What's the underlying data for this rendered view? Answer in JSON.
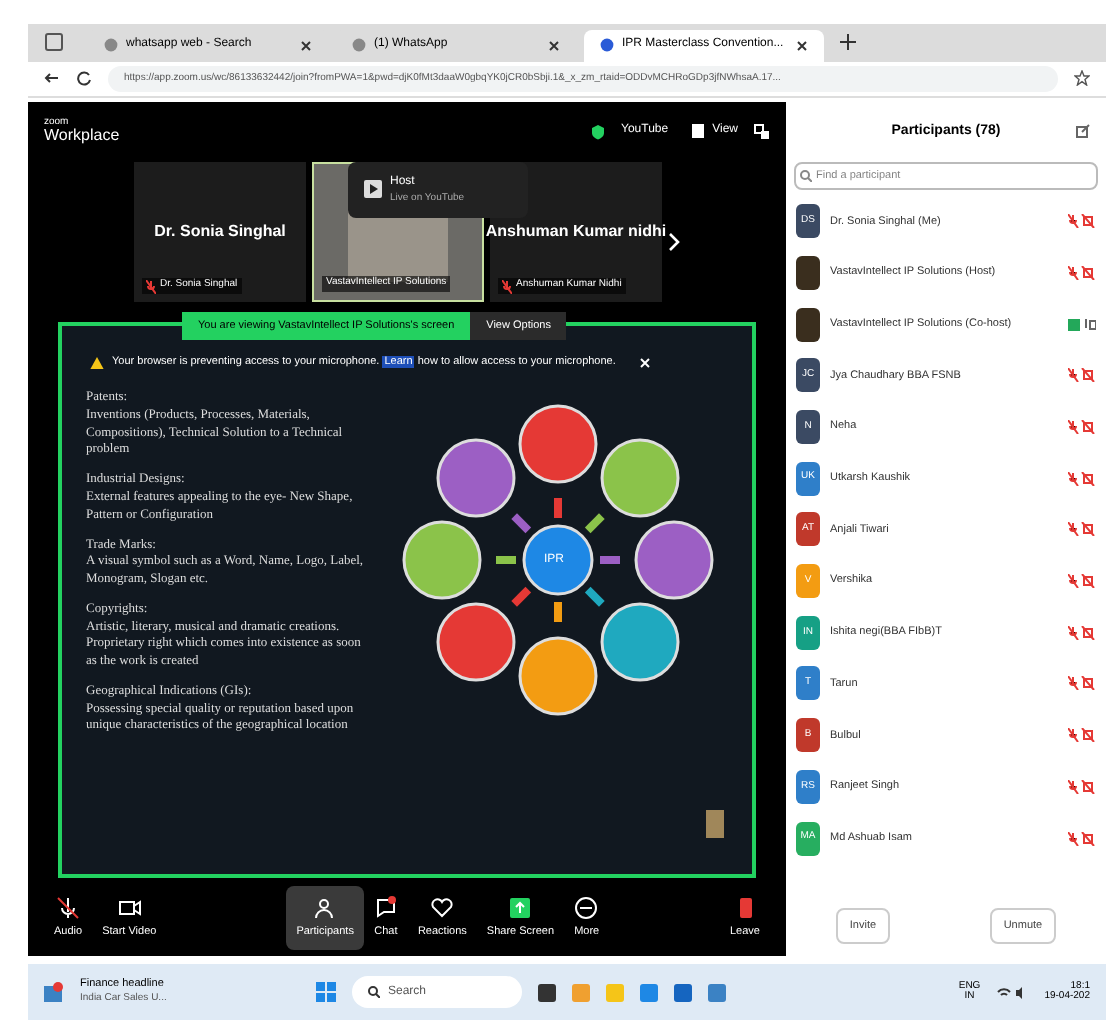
{
  "browser": {
    "tabs": [
      {
        "label": "whatsapp web - Search",
        "selected": false
      },
      {
        "label": "(1) WhatsApp",
        "selected": false
      },
      {
        "label": "IPR Masterclass Convention...",
        "selected": true
      }
    ],
    "url": "https://app.zoom.us/wc/86133632442/join?fromPWA=1&pwd=djK0fMt3daaW0gbqYK0jCR0bSbji.1&_x_zm_rtaid=ODDvMCHRoGDp3jfNWhsaA.17..."
  },
  "meeting": {
    "brand": "zoom",
    "product": "Workplace",
    "stream": "YouTube",
    "view": "View",
    "host_popup": {
      "title": "Host",
      "subtitle": "Live on YouTube"
    },
    "tiles": [
      {
        "kind": "name",
        "name": "Dr. Sonia Singhal",
        "caption": "Dr. Sonia Singhal",
        "muted": true
      },
      {
        "kind": "video",
        "caption": "VastavIntellect IP Solutions",
        "muted": false
      },
      {
        "kind": "name",
        "name": "Anshuman Kumar nidhi",
        "caption": "Anshuman Kumar Nidhi",
        "muted": true
      }
    ],
    "viewing_banner": "You are viewing VastavIntellect IP Solutions's screen",
    "view_options": "View Options",
    "warning": {
      "before": "Your browser is preventing access to your microphone.",
      "link": "Learn",
      "after": "how to allow access to your microphone."
    },
    "slide": {
      "paragraphs": [
        {
          "heading": "Patents:",
          "body": "Inventions (Products, Processes, Materials, Compositions), Technical Solution to a Technical problem"
        },
        {
          "heading": "Industrial Designs:",
          "body": "External features appealing to the eye- New Shape, Pattern or Configuration"
        },
        {
          "heading": "Trade Marks:",
          "body": "A visual symbol such as a Word, Name, Logo, Label, Monogram, Slogan etc."
        },
        {
          "heading": "Copyrights:",
          "body": "Artistic, literary, musical and dramatic creations. Proprietary right which comes into existence as soon as the work is created"
        },
        {
          "heading": "Geographical Indications (GIs):",
          "body": "Possessing special quality or reputation based upon unique characteristics of the geographical location"
        }
      ],
      "center": "IPR",
      "circles": [
        {
          "color": "#e53935"
        },
        {
          "color": "#8bc34a"
        },
        {
          "color": "#9c5fc4"
        },
        {
          "color": "#1fa9bf"
        },
        {
          "color": "#f39c12"
        },
        {
          "color": "#e53935"
        },
        {
          "color": "#8bc34a"
        },
        {
          "color": "#9c5fc4"
        }
      ]
    },
    "toolbar": [
      {
        "label": "Audio",
        "kind": "mic",
        "selected": false
      },
      {
        "label": "Start Video",
        "kind": "video",
        "selected": false
      },
      {
        "label": "Participants",
        "kind": "people",
        "selected": true
      },
      {
        "label": "Chat",
        "kind": "chat",
        "selected": false
      },
      {
        "label": "Reactions",
        "kind": "heart",
        "selected": false
      },
      {
        "label": "Share Screen",
        "kind": "share",
        "selected": false
      },
      {
        "label": "More",
        "kind": "more",
        "selected": false
      },
      {
        "label": "Leave",
        "kind": "leave",
        "selected": false
      }
    ]
  },
  "participants": {
    "title": "Participants (78)",
    "search_placeholder": "Find a participant",
    "items": [
      {
        "kind": "initials",
        "initials": "DS",
        "name": "Dr. Sonia Singhal (Me)",
        "color": "#3b4a63",
        "muted": true
      },
      {
        "kind": "photo",
        "name": "VastavIntellect IP Solutions (Host)",
        "muted": true
      },
      {
        "kind": "photo",
        "name": "VastavIntellect IP Solutions (Co-host)",
        "muted": false
      },
      {
        "kind": "initials",
        "initials": "JC",
        "name": "Jya Chaudhary BBA FSNB",
        "color": "#3b4a63",
        "muted": true
      },
      {
        "kind": "initials",
        "initials": "N",
        "name": "Neha",
        "color": "#3b4a63",
        "muted": true
      },
      {
        "kind": "initials",
        "initials": "UK",
        "name": "Utkarsh Kaushik",
        "color": "#2f7fc9",
        "muted": true
      },
      {
        "kind": "initials",
        "initials": "AT",
        "name": "Anjali Tiwari",
        "color": "#c0392b",
        "muted": true
      },
      {
        "kind": "initials",
        "initials": "V",
        "name": "Vershika",
        "color": "#f39c12",
        "muted": true
      },
      {
        "kind": "initials",
        "initials": "IN",
        "name": "Ishita negi(BBA FIbB)T",
        "color": "#16a085",
        "muted": true
      },
      {
        "kind": "initials",
        "initials": "T",
        "name": "Tarun",
        "color": "#2f7fc9",
        "muted": true
      },
      {
        "kind": "initials",
        "initials": "B",
        "name": "Bulbul",
        "color": "#c0392b",
        "muted": true
      },
      {
        "kind": "initials",
        "initials": "RS",
        "name": "Ranjeet Singh",
        "color": "#2f7fc9",
        "muted": true
      },
      {
        "kind": "initials",
        "initials": "MA",
        "name": "Md Ashuab Isam",
        "color": "#27ae60",
        "muted": true
      }
    ],
    "buttons": [
      "Invite",
      "Unmute"
    ]
  },
  "taskbar": {
    "news_title": "Finance headline",
    "news_text": "India Car Sales U...",
    "search": "Search",
    "lang": "ENG",
    "region": "IN",
    "time": "18:1",
    "date": "19-04-202"
  }
}
